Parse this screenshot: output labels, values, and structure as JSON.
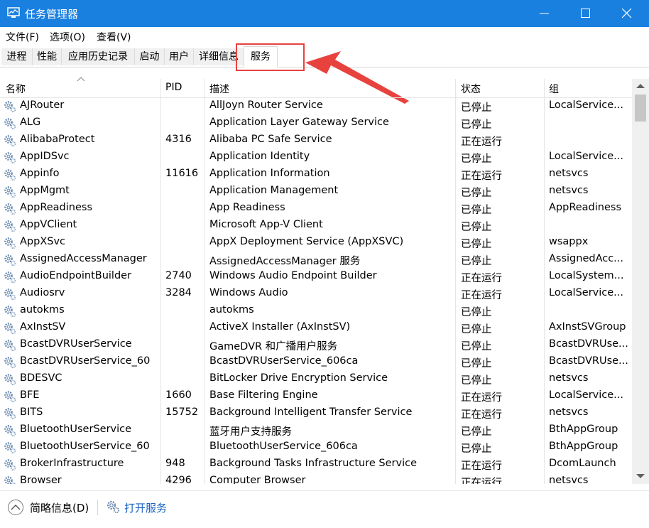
{
  "window": {
    "title": "任务管理器",
    "title_bar_color": "#1a80e0"
  },
  "menu": [
    {
      "label": "文件(F)"
    },
    {
      "label": "选项(O)"
    },
    {
      "label": "查看(V)"
    }
  ],
  "tabs": [
    {
      "label": "进程"
    },
    {
      "label": "性能"
    },
    {
      "label": "应用历史记录"
    },
    {
      "label": "启动"
    },
    {
      "label": "用户"
    },
    {
      "label": "详细信息"
    },
    {
      "label": "服务",
      "selected": true
    }
  ],
  "annotation": {
    "color": "#e8423f"
  },
  "columns": {
    "name": "名称",
    "pid": "PID",
    "description": "描述",
    "status": "状态",
    "group": "组"
  },
  "services": [
    {
      "name": "AJRouter",
      "pid": "",
      "description": "AllJoyn Router Service",
      "status": "已停止",
      "group": "LocalService..."
    },
    {
      "name": "ALG",
      "pid": "",
      "description": "Application Layer Gateway Service",
      "status": "已停止",
      "group": ""
    },
    {
      "name": "AlibabaProtect",
      "pid": "4316",
      "description": "Alibaba PC Safe Service",
      "status": "正在运行",
      "group": ""
    },
    {
      "name": "AppIDSvc",
      "pid": "",
      "description": "Application Identity",
      "status": "已停止",
      "group": "LocalService..."
    },
    {
      "name": "Appinfo",
      "pid": "11616",
      "description": "Application Information",
      "status": "正在运行",
      "group": "netsvcs"
    },
    {
      "name": "AppMgmt",
      "pid": "",
      "description": "Application Management",
      "status": "已停止",
      "group": "netsvcs"
    },
    {
      "name": "AppReadiness",
      "pid": "",
      "description": "App Readiness",
      "status": "已停止",
      "group": "AppReadiness"
    },
    {
      "name": "AppVClient",
      "pid": "",
      "description": "Microsoft App-V Client",
      "status": "已停止",
      "group": ""
    },
    {
      "name": "AppXSvc",
      "pid": "",
      "description": "AppX Deployment Service (AppXSVC)",
      "status": "已停止",
      "group": "wsappx"
    },
    {
      "name": "AssignedAccessManager",
      "pid": "",
      "description": "AssignedAccessManager 服务",
      "status": "已停止",
      "group": "AssignedAcc..."
    },
    {
      "name": "AudioEndpointBuilder",
      "pid": "2740",
      "description": "Windows Audio Endpoint Builder",
      "status": "正在运行",
      "group": "LocalSystem..."
    },
    {
      "name": "Audiosrv",
      "pid": "3284",
      "description": "Windows Audio",
      "status": "正在运行",
      "group": "LocalService..."
    },
    {
      "name": "autokms",
      "pid": "",
      "description": "autokms",
      "status": "已停止",
      "group": ""
    },
    {
      "name": "AxInstSV",
      "pid": "",
      "description": "ActiveX Installer (AxInstSV)",
      "status": "已停止",
      "group": "AxInstSVGroup"
    },
    {
      "name": "BcastDVRUserService",
      "pid": "",
      "description": "GameDVR 和广播用户服务",
      "status": "已停止",
      "group": "BcastDVRUse..."
    },
    {
      "name": "BcastDVRUserService_60",
      "pid": "",
      "description": "BcastDVRUserService_606ca",
      "status": "已停止",
      "group": "BcastDVRUse..."
    },
    {
      "name": "BDESVC",
      "pid": "",
      "description": "BitLocker Drive Encryption Service",
      "status": "已停止",
      "group": "netsvcs"
    },
    {
      "name": "BFE",
      "pid": "1660",
      "description": "Base Filtering Engine",
      "status": "正在运行",
      "group": "LocalService..."
    },
    {
      "name": "BITS",
      "pid": "15752",
      "description": "Background Intelligent Transfer Service",
      "status": "正在运行",
      "group": "netsvcs"
    },
    {
      "name": "BluetoothUserService",
      "pid": "",
      "description": "蓝牙用户支持服务",
      "status": "已停止",
      "group": "BthAppGroup"
    },
    {
      "name": "BluetoothUserService_60",
      "pid": "",
      "description": "BluetoothUserService_606ca",
      "status": "已停止",
      "group": "BthAppGroup"
    },
    {
      "name": "BrokerInfrastructure",
      "pid": "948",
      "description": "Background Tasks Infrastructure Service",
      "status": "正在运行",
      "group": "DcomLaunch"
    },
    {
      "name": "Browser",
      "pid": "4296",
      "description": "Computer Browser",
      "status": "正在运行",
      "group": "netsvcs"
    }
  ],
  "footer": {
    "brief_label": "简略信息(D)",
    "open_services_label": "打开服务"
  }
}
